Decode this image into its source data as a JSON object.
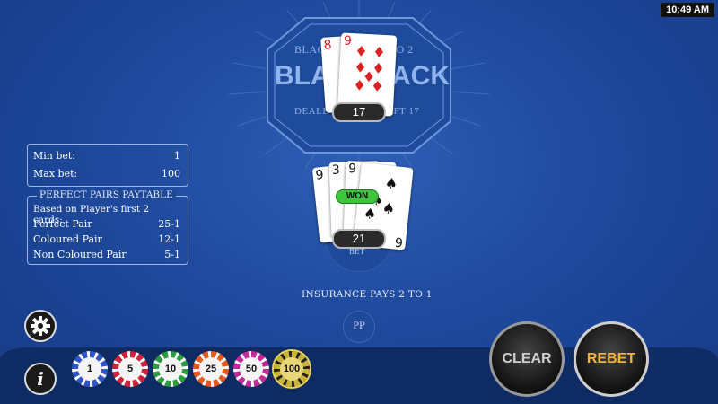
{
  "status_bar": {
    "time": "10:49 AM"
  },
  "table_badge": {
    "top_left": "BLAC",
    "top_right": "TO 2",
    "title_left": "BLA",
    "title_right": "ACK",
    "bottom_left": "DEALE",
    "bottom_right": "OFT 17"
  },
  "dealer": {
    "cards": [
      {
        "rank": "8",
        "suit": "♦",
        "color": "red"
      },
      {
        "rank": "9",
        "suit": "♦",
        "color": "red"
      }
    ],
    "total": "17"
  },
  "player": {
    "cards": [
      {
        "rank": "9",
        "suit": "♠",
        "color": "black"
      },
      {
        "rank": "3",
        "suit": "♠",
        "color": "black"
      },
      {
        "rank": "9",
        "suit": "♠",
        "color": "black"
      },
      {
        "rank": "6",
        "suit": "♠",
        "color": "black"
      }
    ],
    "result": "WON",
    "total": "21",
    "bet_spot_label": "BET"
  },
  "limits": {
    "min_label": "Min bet:",
    "min_value": "1",
    "max_label": "Max bet:",
    "max_value": "100"
  },
  "paytable": {
    "title": "PERFECT PAIRS PAYTABLE",
    "subtitle": "Based on Player's first 2 cards:",
    "rows": [
      {
        "label": "Perfect Pair",
        "value": "25-1"
      },
      {
        "label": "Coloured Pair",
        "value": "12-1"
      },
      {
        "label": "Non Coloured Pair",
        "value": "5-1"
      }
    ]
  },
  "insurance": "INSURANCE PAYS 2 TO 1",
  "pp_spot": "PP",
  "chips": [
    {
      "value": "1",
      "color": "#2f56c4"
    },
    {
      "value": "5",
      "color": "#d1223a"
    },
    {
      "value": "10",
      "color": "#2e9b3f"
    },
    {
      "value": "25",
      "color": "#e35a1c"
    },
    {
      "value": "50",
      "color": "#c22a9c"
    },
    {
      "value": "100",
      "color": "#c9b23a"
    }
  ],
  "buttons": {
    "clear": "CLEAR",
    "rebet": "REBET",
    "settings_icon": "gear-icon",
    "info_icon": "info-icon",
    "info_glyph": "i"
  }
}
